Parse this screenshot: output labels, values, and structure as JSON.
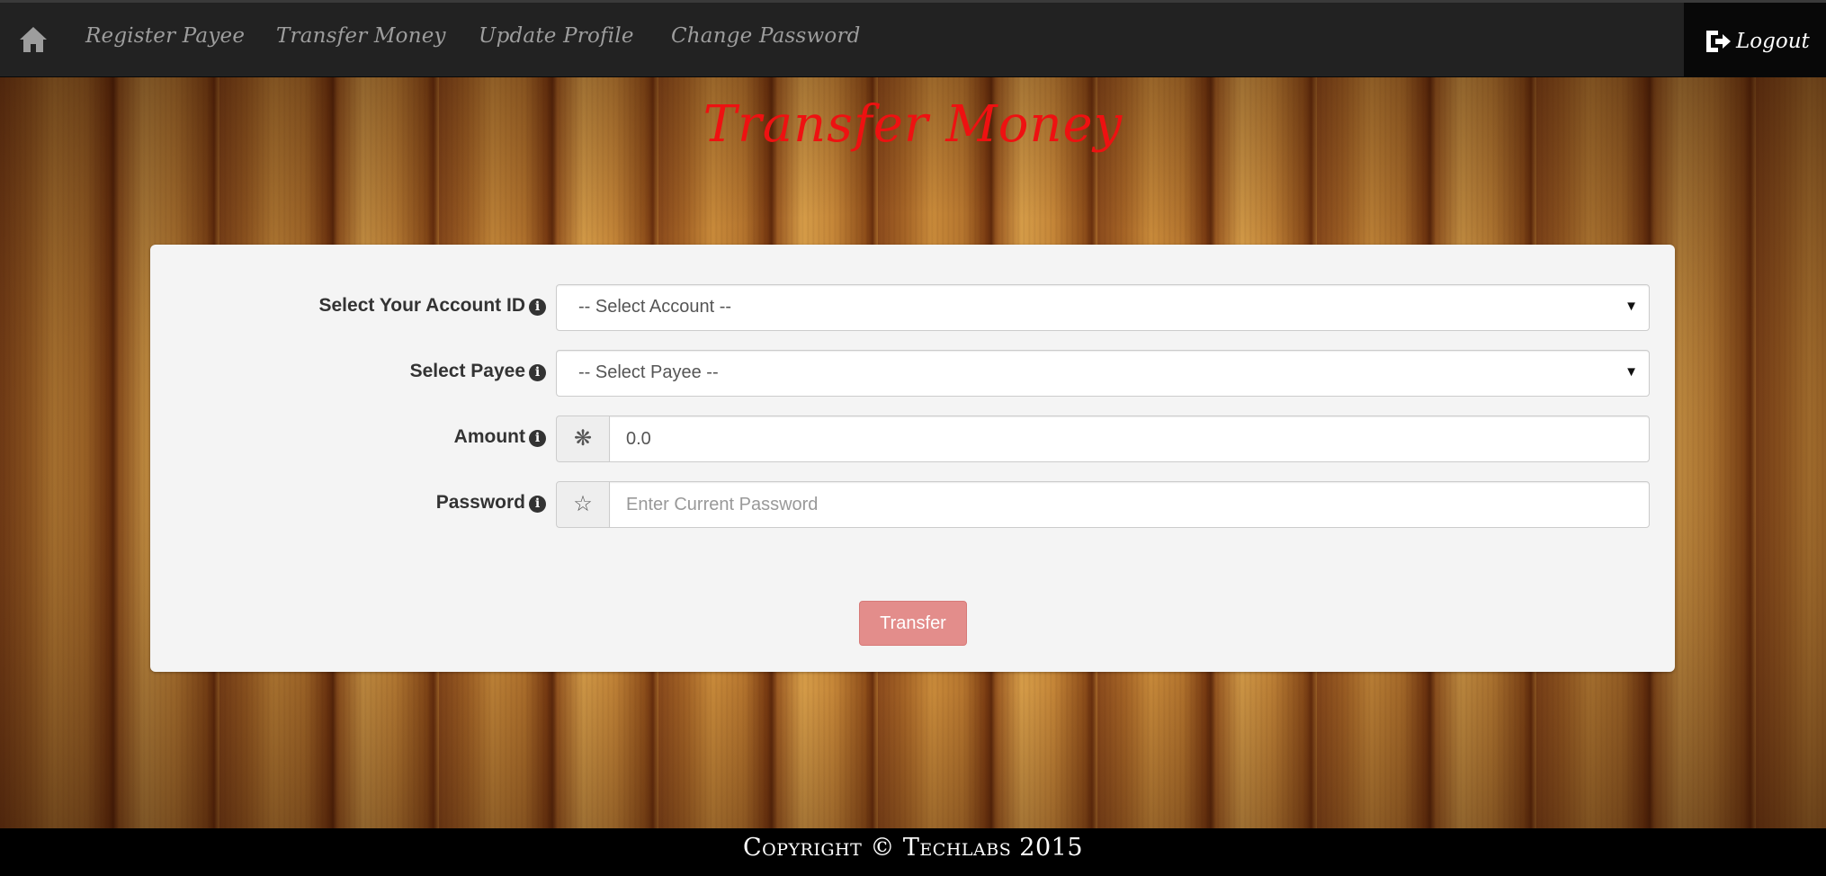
{
  "nav": {
    "items": [
      {
        "label": "Register Payee"
      },
      {
        "label": "Transfer Money"
      },
      {
        "label": "Update Profile"
      },
      {
        "label": "Change Password"
      }
    ],
    "logout_label": "Logout",
    "home_icon": "home-icon",
    "logout_icon": "logout-icon"
  },
  "page": {
    "title": "Transfer Money",
    "title_color": "#ee1111"
  },
  "form": {
    "account": {
      "label": "Select Your Account ID",
      "value": "-- Select Account --"
    },
    "payee": {
      "label": "Select Payee",
      "value": "-- Select Payee --"
    },
    "amount": {
      "label": "Amount",
      "value": "0.0",
      "icon": "asterisk-icon"
    },
    "password": {
      "label": "Password",
      "placeholder": "Enter Current Password",
      "icon": "star-icon"
    },
    "submit_label": "Transfer"
  },
  "colors": {
    "navbar": "#222222",
    "button": "#e38d8b"
  },
  "footer": {
    "text": "Copyright © Techlabs 2015"
  }
}
